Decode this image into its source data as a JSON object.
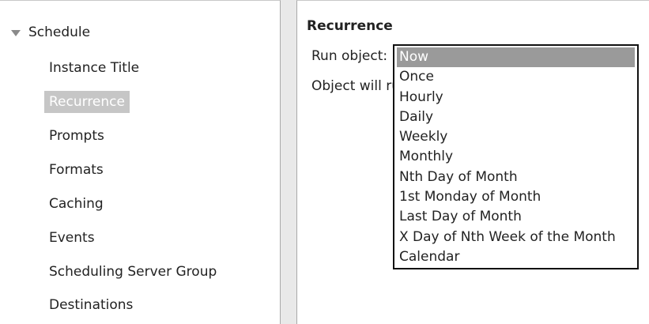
{
  "sidebar": {
    "root_label": "Schedule",
    "items": [
      {
        "label": "Instance Title"
      },
      {
        "label": "Recurrence"
      },
      {
        "label": "Prompts"
      },
      {
        "label": "Formats"
      },
      {
        "label": "Caching"
      },
      {
        "label": "Events"
      },
      {
        "label": "Scheduling Server Group"
      },
      {
        "label": "Destinations"
      }
    ],
    "selected": "Recurrence"
  },
  "main": {
    "title": "Recurrence",
    "run_object_label": "Run object:",
    "object_will_run_label": "Object will run",
    "dropdown": {
      "highlighted": "Now",
      "options": [
        "Now",
        "Once",
        "Hourly",
        "Daily",
        "Weekly",
        "Monthly",
        "Nth Day of Month",
        "1st Monday of Month",
        "Last Day of Month",
        "X Day of Nth Week of the Month",
        "Calendar"
      ]
    }
  },
  "colors": {
    "selected_bg": "#c6c6c6",
    "highlight_bg": "#9a9a9a",
    "dropdown_border": "#111111"
  }
}
